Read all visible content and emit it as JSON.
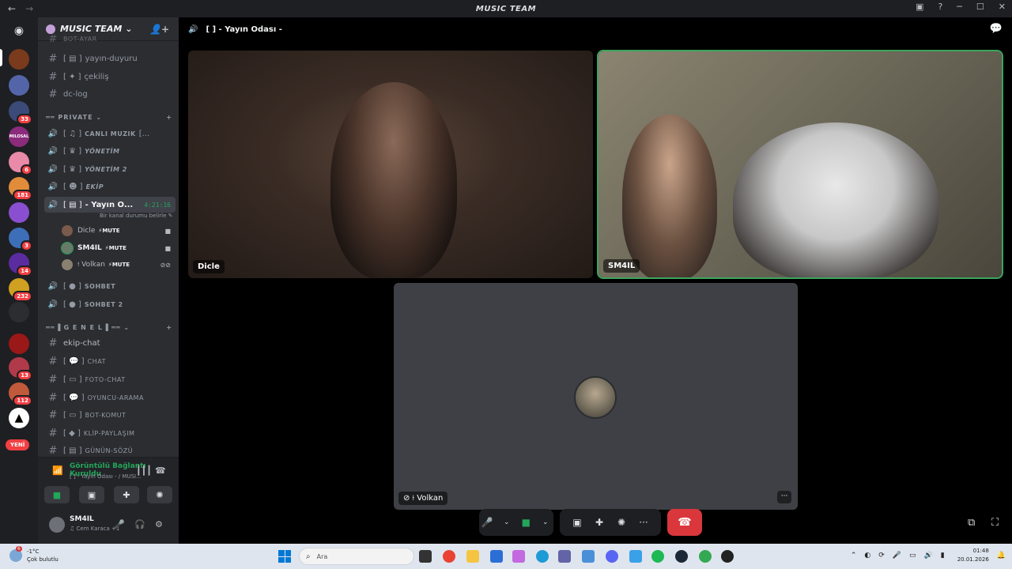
{
  "window": {
    "title": "MUSIC TEAM"
  },
  "guild": {
    "name": "MUSIC TEAM"
  },
  "channels": {
    "top_partial": "BOT-AYAR",
    "yayin_duyuru": "yayın-duyuru",
    "cekilis": "çekiliş",
    "dc_log": "dc-log",
    "cat_private": "PRIVATE",
    "canli_muzik": "CANLI MUZIK",
    "yonetim": "YÖNETİM",
    "yonetim2": "YÖNETİM 2",
    "ekip": "EKİP",
    "yayin_odasi": "- Yayın O...",
    "yayin_timer": "4:21:16",
    "status_hint": "Bir kanal durumu belirle",
    "sohbet": "SOHBET",
    "sohbet2": "SOHBET 2",
    "cat_genel": "G E N E L",
    "ekip_chat": "ekip-chat",
    "chat": "CHAT",
    "foto_chat": "FOTO-CHAT",
    "oyuncu_arama": "OYUNCU-ARAMA",
    "bot_komut": "BOT-KOMUT",
    "klip_paylasim": "KLİP-PAYLAŞIM",
    "gunun_sozu": "GÜNÜN-SÖZÜ"
  },
  "voice_users": [
    {
      "name": "Dicle",
      "tag": "MUTE"
    },
    {
      "name": "SM4IL",
      "tag": "MUTE"
    },
    {
      "name": "Volkan",
      "tag": "MUTE"
    }
  ],
  "servers": {
    "badges": [
      "33",
      "6",
      "181",
      "3",
      "14",
      "232",
      "13",
      "112"
    ],
    "new_label": "YENİ",
    "text_server": "MILOSAL"
  },
  "connection": {
    "status": "Görüntülü Bağlantı Kuruldu",
    "channel": "[ ] - Yayın Odası - / MUSI..."
  },
  "user": {
    "name": "SM4IL",
    "activity": "Cem Karaca +1"
  },
  "call": {
    "header": "[ ] - Yayın Odası -",
    "tiles": [
      {
        "name": "Dicle"
      },
      {
        "name": "SM4IL",
        "speaking": true
      },
      {
        "name": "Volkan"
      }
    ]
  },
  "taskbar": {
    "weather_temp": "-1°C",
    "weather_desc": "Çok bulutlu",
    "weather_badge": "6",
    "search_placeholder": "Ara",
    "time": "01:48",
    "date": "20.01.2026"
  },
  "colors": {
    "accent": "#5865f2",
    "speaking": "#3ba55d",
    "danger": "#da373c",
    "online": "#23a55a"
  }
}
